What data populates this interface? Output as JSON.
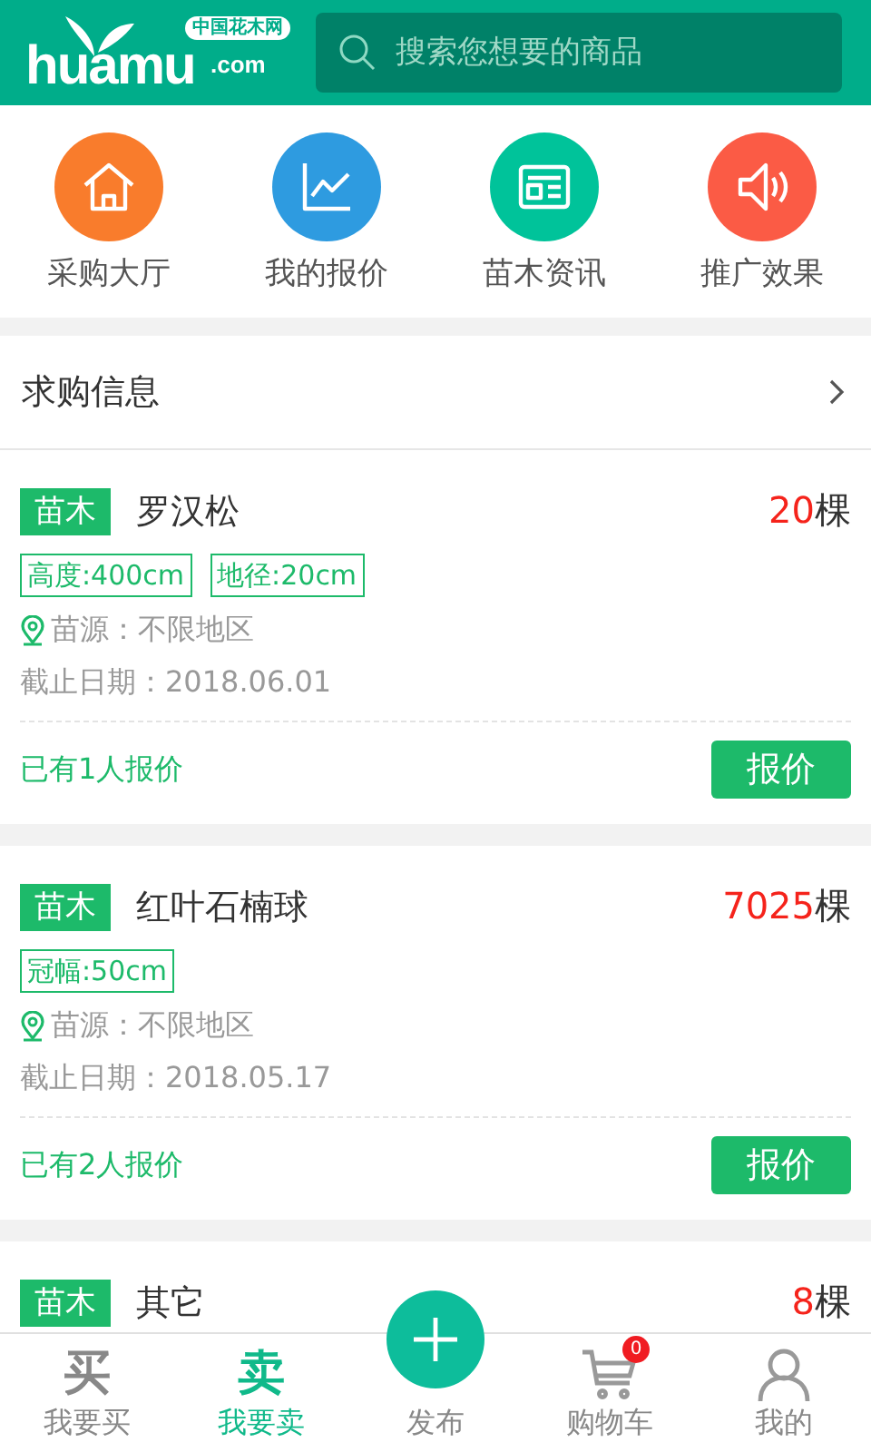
{
  "header": {
    "logo": {
      "brand": "huamu",
      "domain": ".com",
      "site_name": "中国花木网"
    },
    "search": {
      "placeholder": "搜索您想要的商品"
    }
  },
  "quick_links": [
    {
      "label": "采购大厅",
      "kind": "home",
      "color": "#f97c2c"
    },
    {
      "label": "我的报价",
      "kind": "chart",
      "color": "#2e9be0"
    },
    {
      "label": "苗木资讯",
      "kind": "news",
      "color": "#00c39a"
    },
    {
      "label": "推广效果",
      "kind": "speaker",
      "color": "#fb5b45"
    }
  ],
  "section": {
    "title": "求购信息"
  },
  "requests": [
    {
      "category": "苗木",
      "name": "罗汉松",
      "quantity": "20",
      "unit": "棵",
      "specs": [
        "高度:400cm",
        "地径:20cm"
      ],
      "origin": "苗源：不限地区",
      "deadline": "截止日期：2018.06.01",
      "quotes": "已有1人报价",
      "button": "报价"
    },
    {
      "category": "苗木",
      "name": "红叶石楠球",
      "quantity": "7025",
      "unit": "棵",
      "specs": [
        "冠幅:50cm"
      ],
      "origin": "苗源：不限地区",
      "deadline": "截止日期：2018.05.17",
      "quotes": "已有2人报价",
      "button": "报价"
    },
    {
      "category": "苗木",
      "name": "其它",
      "quantity": "8",
      "unit": "棵"
    }
  ],
  "tab_bar": [
    {
      "label": "我要买",
      "kind": "glyph",
      "glyph": "买",
      "selected": false
    },
    {
      "label": "我要卖",
      "kind": "glyph",
      "glyph": "卖",
      "selected": true
    },
    {
      "label": "发布",
      "kind": "publish",
      "selected": false
    },
    {
      "label": "购物车",
      "kind": "cart",
      "badge": "0",
      "selected": false
    },
    {
      "label": "我的",
      "kind": "user",
      "selected": false
    }
  ]
}
